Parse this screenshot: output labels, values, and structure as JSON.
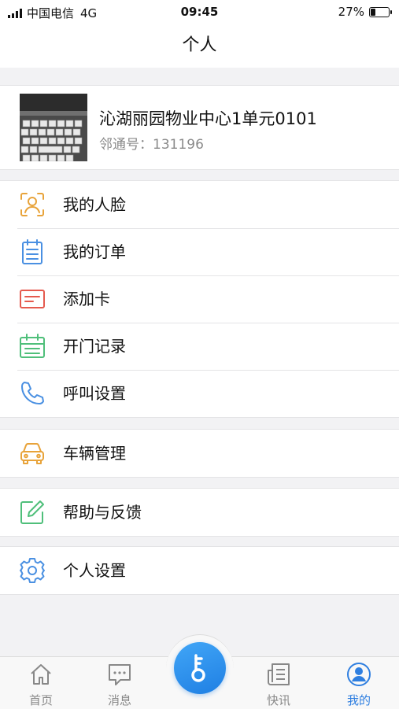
{
  "status_bar": {
    "carrier": "中国电信",
    "network": "4G",
    "time": "09:45",
    "battery": "27%",
    "battery_level": 0.27
  },
  "header": {
    "title": "个人"
  },
  "profile": {
    "name": "沁湖丽园物业中心1单元0101",
    "id_text": "邻通号：131196"
  },
  "menu_group_1": [
    {
      "label": "我的人脸",
      "icon": "face-scan-icon",
      "color": "#e8a33a"
    },
    {
      "label": "我的订单",
      "icon": "order-clipboard-icon",
      "color": "#4a90e2"
    },
    {
      "label": "添加卡",
      "icon": "card-icon",
      "color": "#e55a4e"
    },
    {
      "label": "开门记录",
      "icon": "calendar-icon",
      "color": "#4fbf7a"
    },
    {
      "label": "呼叫设置",
      "icon": "phone-icon",
      "color": "#4a90e2"
    }
  ],
  "menu_group_2": [
    {
      "label": "车辆管理",
      "icon": "car-icon",
      "color": "#e8a33a"
    }
  ],
  "menu_group_3": [
    {
      "label": "帮助与反馈",
      "icon": "edit-icon",
      "color": "#4fbf7a"
    }
  ],
  "menu_group_4": [
    {
      "label": "个人设置",
      "icon": "gear-icon",
      "color": "#4a90e2"
    }
  ],
  "tab_bar": {
    "tabs": [
      {
        "label": "首页",
        "icon": "home-icon"
      },
      {
        "label": "消息",
        "icon": "message-icon"
      },
      {
        "label": "快讯",
        "icon": "news-icon"
      },
      {
        "label": "我的",
        "icon": "user-icon",
        "active": true
      }
    ],
    "center_icon": "key-icon",
    "active_color": "#2f7fe0",
    "inactive_color": "#888888"
  }
}
